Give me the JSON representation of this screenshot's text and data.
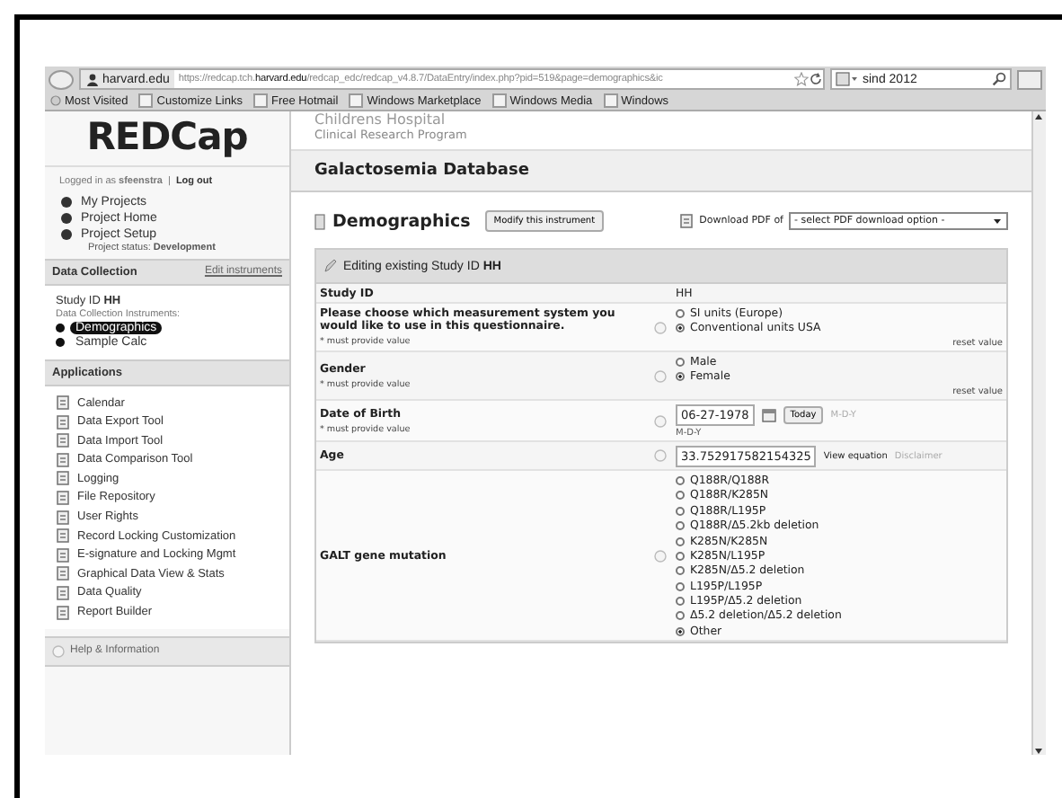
{
  "browser": {
    "site": "harvard.edu",
    "url": "https://redcap.tch.**harvard.edu**/redcap_edc/redcap_v4.8.7/DataEntry/index.php?pid=519&page=demographics&ic",
    "search": "sind 2012",
    "bookmarks": [
      "Most Visited",
      "Customize Links",
      "Free Hotmail",
      "Windows Marketplace",
      "Windows Media",
      "Windows"
    ]
  },
  "sidebar": {
    "logo": "REDCap",
    "logged_in": "Logged in as **sfeenstra**",
    "separator": "|",
    "logout": "Log out",
    "project_links": [
      "My Projects",
      "Project Home",
      "Project Setup"
    ],
    "project_status": "Project status: **Development**",
    "data_collection": {
      "title": "Data Collection",
      "edit_link": "Edit instruments",
      "study": "Study ID **HH**",
      "instruments_label": "Data Collection Instruments:",
      "instruments": [
        {
          "label": "Demographics",
          "selected": true
        },
        {
          "label": "Sample Calc",
          "selected": false
        }
      ]
    },
    "applications": {
      "title": "Applications",
      "items": [
        "Calendar",
        "Data Export Tool",
        "Data Import Tool",
        "Data Comparison Tool",
        "Logging",
        "File Repository",
        "User Rights",
        "Record Locking Customization",
        "E-signature and Locking Mgmt",
        "Graphical Data View & Stats",
        "Data Quality",
        "Report Builder"
      ]
    },
    "help": "Help & Information"
  },
  "header": {
    "org": "Childrens Hospital",
    "program": "Clinical Research Program",
    "project": "Galactosemia Database"
  },
  "instrument": {
    "title": "Demographics",
    "modify": "Modify this instrument",
    "pdf_label": "Download PDF of",
    "pdf_select": "- select PDF download option -"
  },
  "form": {
    "header": "Editing existing Study ID **HH**",
    "rows": [
      {
        "kind": "text",
        "label": "Study ID",
        "value": "HH"
      },
      {
        "kind": "radio",
        "label": "Please choose which measurement system you would like to use in this questionnaire.",
        "note": "* must provide value",
        "reset": "reset value",
        "options": [
          {
            "label": "SI units (Europe)",
            "selected": false
          },
          {
            "label": "Conventional units USA",
            "selected": true
          }
        ]
      },
      {
        "kind": "radio",
        "label": "Gender",
        "note": "* must provide value",
        "reset": "reset value",
        "options": [
          {
            "label": "Male",
            "selected": false
          },
          {
            "label": "Female",
            "selected": true
          }
        ]
      },
      {
        "kind": "date",
        "label": "Date of Birth",
        "note": "* must provide value",
        "value": "06-27-1978",
        "button": "Today",
        "format": "M-D-Y",
        "format_below": "M-D-Y"
      },
      {
        "kind": "calc",
        "label": "Age",
        "value": "33.752917582154325",
        "link": "View equation",
        "disclaimer": "Disclaimer"
      },
      {
        "kind": "radio",
        "label": "GALT gene mutation",
        "options": [
          {
            "label": "Q188R/Q188R",
            "selected": false
          },
          {
            "label": "Q188R/K285N",
            "selected": false
          },
          {
            "label": "Q188R/L195P",
            "selected": false
          },
          {
            "label": "Q188R/Δ5.2kb deletion",
            "selected": false
          },
          {
            "label": "K285N/K285N",
            "selected": false
          },
          {
            "label": "K285N/L195P",
            "selected": false
          },
          {
            "label": "K285N/Δ5.2 deletion",
            "selected": false
          },
          {
            "label": "L195P/L195P",
            "selected": false
          },
          {
            "label": "L195P/Δ5.2 deletion",
            "selected": false
          },
          {
            "label": "Δ5.2 deletion/Δ5.2 deletion",
            "selected": false
          },
          {
            "label": "Other",
            "selected": true
          }
        ]
      }
    ]
  }
}
